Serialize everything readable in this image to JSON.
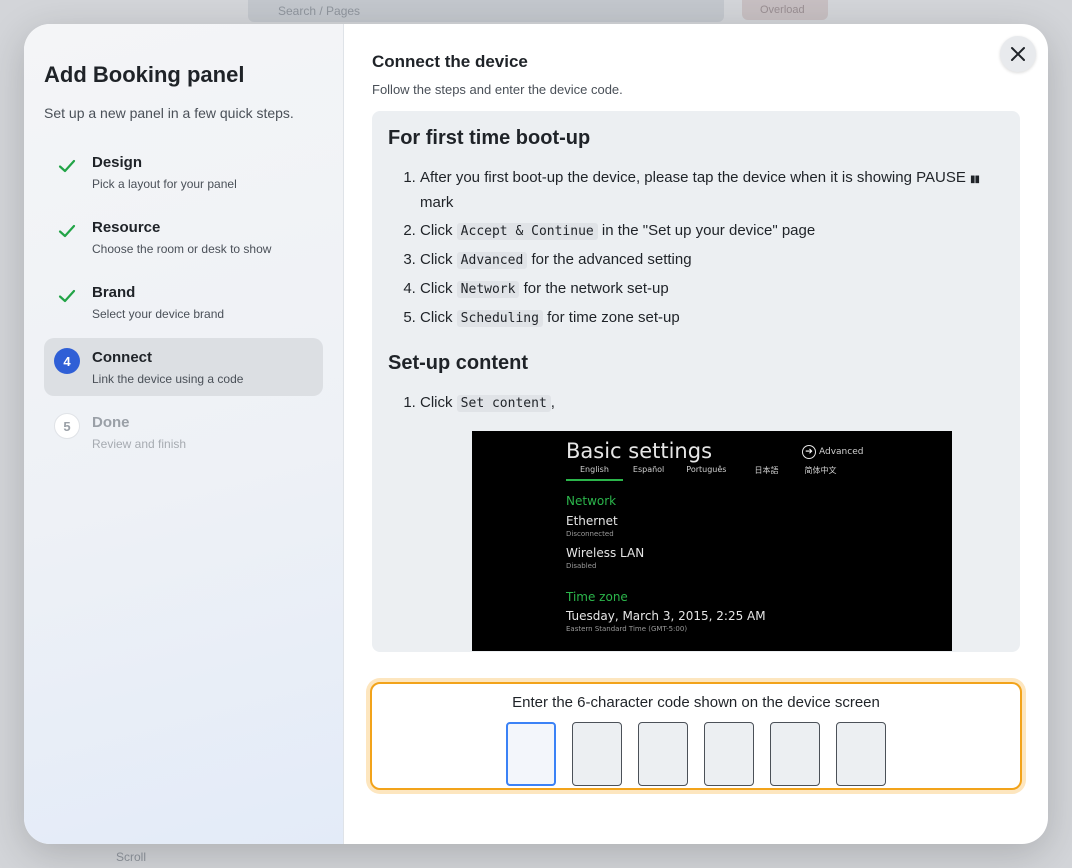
{
  "background": {
    "search_placeholder": "Search / Pages",
    "button_label": "Overload",
    "bottom_text": "Scroll"
  },
  "sidebar": {
    "title": "Add Booking panel",
    "subtitle": "Set up a new panel in a few quick steps.",
    "steps": [
      {
        "title": "Design",
        "desc": "Pick a layout for your panel",
        "status": "done"
      },
      {
        "title": "Resource",
        "desc": "Choose the room or desk to show",
        "status": "done"
      },
      {
        "title": "Brand",
        "desc": "Select your device brand",
        "status": "done"
      },
      {
        "number": "4",
        "title": "Connect",
        "desc": "Link the device using a code",
        "status": "active"
      },
      {
        "number": "5",
        "title": "Done",
        "desc": "Review and finish",
        "status": "pending"
      }
    ]
  },
  "main": {
    "title": "Connect the device",
    "subtitle": "Follow the steps and enter the device code.",
    "close_icon": "close-icon",
    "first_boot": {
      "heading": "For first time boot-up",
      "step1_text": "After you first boot-up the device, please tap the device when it is showing PAUSE",
      "step1_glyph": "▮▮",
      "step1_suffix": "mark",
      "step2_prefix": "Click",
      "step2_code": "Accept & Continue",
      "step2_suffix": "in the \"Set up your device\" page",
      "step3_prefix": "Click",
      "step3_code": "Advanced",
      "step3_suffix": "for the advanced setting",
      "step4_prefix": "Click",
      "step4_code": "Network",
      "step4_suffix": "for the network set-up",
      "step5_prefix": "Click",
      "step5_code": "Scheduling",
      "step5_suffix": "for time zone set-up"
    },
    "setup_content": {
      "heading": "Set-up content",
      "step1_prefix": "Click",
      "step1_code": "Set content",
      "step1_suffix": ","
    },
    "device_screenshot": {
      "title": "Basic settings",
      "advanced_label": "Advanced",
      "languages": [
        "English",
        "Español",
        "Português",
        "日本語",
        "简体中文"
      ],
      "network_heading": "Network",
      "ethernet_label": "Ethernet",
      "ethernet_status": "Disconnected",
      "wireless_label": "Wireless LAN",
      "wireless_status": "Disabled",
      "timezone_heading": "Time zone",
      "datetime": "Tuesday, March 3, 2015, 2:25 AM",
      "timezone": "Eastern Standard Time (GMT-5:00)"
    },
    "code_entry": {
      "label": "Enter the 6-character code shown on the device screen",
      "values": [
        "",
        "",
        "",
        "",
        "",
        ""
      ]
    }
  },
  "colors": {
    "accent_blue": "#2f5fd6",
    "check_green": "#22a447",
    "code_border_orange": "#f2a31a",
    "focus_blue": "#3b82f6"
  }
}
